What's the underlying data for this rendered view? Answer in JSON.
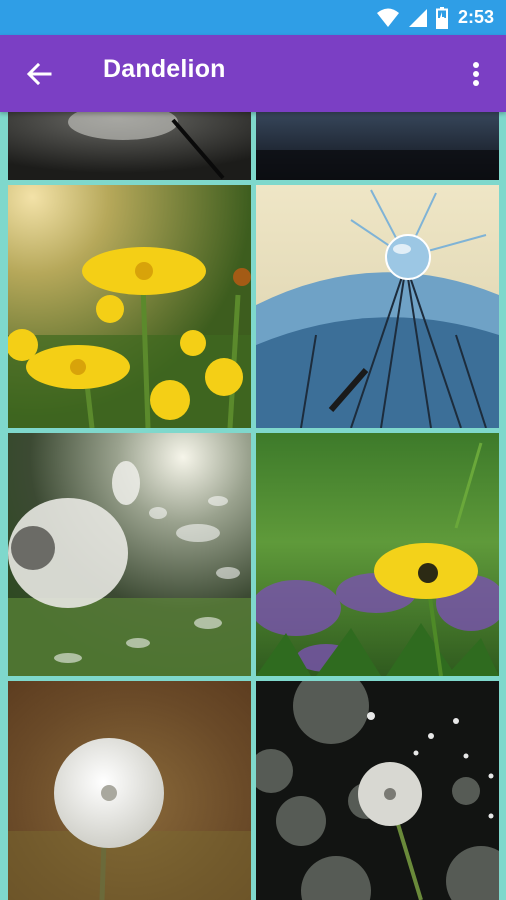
{
  "status_bar": {
    "time": "2:53",
    "icons": [
      "wifi-icon",
      "signal-icon",
      "battery-icon"
    ]
  },
  "app_bar": {
    "title": "Dandelion",
    "back_icon": "arrow-left-icon",
    "menu_icon": "more-vertical-icon"
  },
  "colors": {
    "status_bar": "#2f9ee6",
    "app_bar": "#7b3fc4",
    "grid_background": "#7fd8cc"
  },
  "gallery": {
    "images": [
      "dandelion-seed-dark",
      "dark-blue-night",
      "yellow-dandelions-field",
      "blue-seeds-water-drop",
      "seeds-blowing-in-light",
      "yellow-dandelion-purple-flowers",
      "dandelion-clock-brown-bokeh",
      "dandelion-clock-dark-bokeh"
    ]
  }
}
